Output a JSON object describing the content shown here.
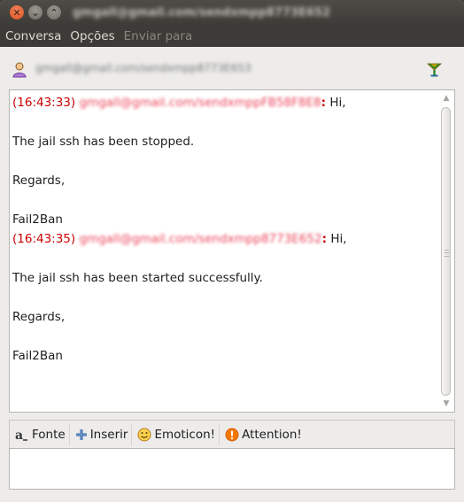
{
  "window": {
    "title": "gmgall@gmail.com/sendxmpp8773E652"
  },
  "menu": {
    "items": [
      "Conversa",
      "Opções",
      "Enviar para"
    ]
  },
  "contact": {
    "name": "gmgall@gmail.com/sendxmpp8773E653"
  },
  "messages": [
    {
      "time": "(16:43:33)",
      "sender": "gmgall@gmail.com/sendxmppFB58F8E8",
      "colon": ":",
      "lines": [
        "Hi,",
        "",
        "The jail ssh has been stopped.",
        "",
        "Regards,",
        "",
        "Fail2Ban"
      ]
    },
    {
      "time": "(16:43:35)",
      "sender": "gmgall@gmail.com/sendxmpp8773E652",
      "colon": ":",
      "lines": [
        "Hi,",
        "",
        "The jail ssh has been started successfully.",
        "",
        "Regards,",
        "",
        "Fail2Ban"
      ]
    }
  ],
  "toolbar": {
    "font": "Fonte",
    "insert": "Inserir",
    "emoticon": "Emoticon!",
    "attention": "Attention!"
  },
  "input": {
    "value": ""
  },
  "colors": {
    "timestamp": "#cc0000",
    "titlebar": "#3c3b37",
    "close_button": "#e2581f"
  }
}
